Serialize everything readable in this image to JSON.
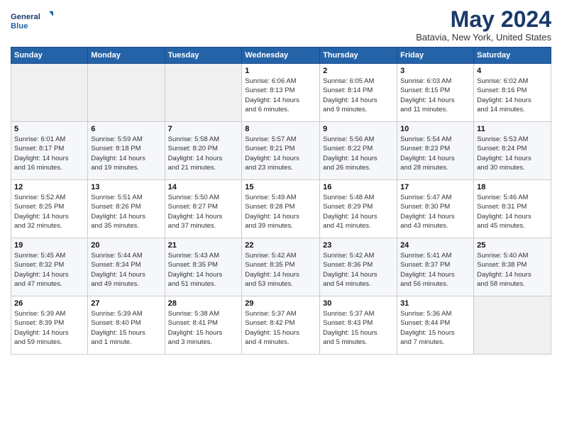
{
  "header": {
    "logo_line1": "General",
    "logo_line2": "Blue",
    "title": "May 2024",
    "subtitle": "Batavia, New York, United States"
  },
  "days_of_week": [
    "Sunday",
    "Monday",
    "Tuesday",
    "Wednesday",
    "Thursday",
    "Friday",
    "Saturday"
  ],
  "weeks": [
    [
      {
        "day": "",
        "info": ""
      },
      {
        "day": "",
        "info": ""
      },
      {
        "day": "",
        "info": ""
      },
      {
        "day": "1",
        "info": "Sunrise: 6:06 AM\nSunset: 8:13 PM\nDaylight: 14 hours\nand 6 minutes."
      },
      {
        "day": "2",
        "info": "Sunrise: 6:05 AM\nSunset: 8:14 PM\nDaylight: 14 hours\nand 9 minutes."
      },
      {
        "day": "3",
        "info": "Sunrise: 6:03 AM\nSunset: 8:15 PM\nDaylight: 14 hours\nand 11 minutes."
      },
      {
        "day": "4",
        "info": "Sunrise: 6:02 AM\nSunset: 8:16 PM\nDaylight: 14 hours\nand 14 minutes."
      }
    ],
    [
      {
        "day": "5",
        "info": "Sunrise: 6:01 AM\nSunset: 8:17 PM\nDaylight: 14 hours\nand 16 minutes."
      },
      {
        "day": "6",
        "info": "Sunrise: 5:59 AM\nSunset: 8:18 PM\nDaylight: 14 hours\nand 19 minutes."
      },
      {
        "day": "7",
        "info": "Sunrise: 5:58 AM\nSunset: 8:20 PM\nDaylight: 14 hours\nand 21 minutes."
      },
      {
        "day": "8",
        "info": "Sunrise: 5:57 AM\nSunset: 8:21 PM\nDaylight: 14 hours\nand 23 minutes."
      },
      {
        "day": "9",
        "info": "Sunrise: 5:56 AM\nSunset: 8:22 PM\nDaylight: 14 hours\nand 26 minutes."
      },
      {
        "day": "10",
        "info": "Sunrise: 5:54 AM\nSunset: 8:23 PM\nDaylight: 14 hours\nand 28 minutes."
      },
      {
        "day": "11",
        "info": "Sunrise: 5:53 AM\nSunset: 8:24 PM\nDaylight: 14 hours\nand 30 minutes."
      }
    ],
    [
      {
        "day": "12",
        "info": "Sunrise: 5:52 AM\nSunset: 8:25 PM\nDaylight: 14 hours\nand 32 minutes."
      },
      {
        "day": "13",
        "info": "Sunrise: 5:51 AM\nSunset: 8:26 PM\nDaylight: 14 hours\nand 35 minutes."
      },
      {
        "day": "14",
        "info": "Sunrise: 5:50 AM\nSunset: 8:27 PM\nDaylight: 14 hours\nand 37 minutes."
      },
      {
        "day": "15",
        "info": "Sunrise: 5:49 AM\nSunset: 8:28 PM\nDaylight: 14 hours\nand 39 minutes."
      },
      {
        "day": "16",
        "info": "Sunrise: 5:48 AM\nSunset: 8:29 PM\nDaylight: 14 hours\nand 41 minutes."
      },
      {
        "day": "17",
        "info": "Sunrise: 5:47 AM\nSunset: 8:30 PM\nDaylight: 14 hours\nand 43 minutes."
      },
      {
        "day": "18",
        "info": "Sunrise: 5:46 AM\nSunset: 8:31 PM\nDaylight: 14 hours\nand 45 minutes."
      }
    ],
    [
      {
        "day": "19",
        "info": "Sunrise: 5:45 AM\nSunset: 8:32 PM\nDaylight: 14 hours\nand 47 minutes."
      },
      {
        "day": "20",
        "info": "Sunrise: 5:44 AM\nSunset: 8:34 PM\nDaylight: 14 hours\nand 49 minutes."
      },
      {
        "day": "21",
        "info": "Sunrise: 5:43 AM\nSunset: 8:35 PM\nDaylight: 14 hours\nand 51 minutes."
      },
      {
        "day": "22",
        "info": "Sunrise: 5:42 AM\nSunset: 8:35 PM\nDaylight: 14 hours\nand 53 minutes."
      },
      {
        "day": "23",
        "info": "Sunrise: 5:42 AM\nSunset: 8:36 PM\nDaylight: 14 hours\nand 54 minutes."
      },
      {
        "day": "24",
        "info": "Sunrise: 5:41 AM\nSunset: 8:37 PM\nDaylight: 14 hours\nand 56 minutes."
      },
      {
        "day": "25",
        "info": "Sunrise: 5:40 AM\nSunset: 8:38 PM\nDaylight: 14 hours\nand 58 minutes."
      }
    ],
    [
      {
        "day": "26",
        "info": "Sunrise: 5:39 AM\nSunset: 8:39 PM\nDaylight: 14 hours\nand 59 minutes."
      },
      {
        "day": "27",
        "info": "Sunrise: 5:39 AM\nSunset: 8:40 PM\nDaylight: 15 hours\nand 1 minute."
      },
      {
        "day": "28",
        "info": "Sunrise: 5:38 AM\nSunset: 8:41 PM\nDaylight: 15 hours\nand 3 minutes."
      },
      {
        "day": "29",
        "info": "Sunrise: 5:37 AM\nSunset: 8:42 PM\nDaylight: 15 hours\nand 4 minutes."
      },
      {
        "day": "30",
        "info": "Sunrise: 5:37 AM\nSunset: 8:43 PM\nDaylight: 15 hours\nand 5 minutes."
      },
      {
        "day": "31",
        "info": "Sunrise: 5:36 AM\nSunset: 8:44 PM\nDaylight: 15 hours\nand 7 minutes."
      },
      {
        "day": "",
        "info": ""
      }
    ]
  ]
}
